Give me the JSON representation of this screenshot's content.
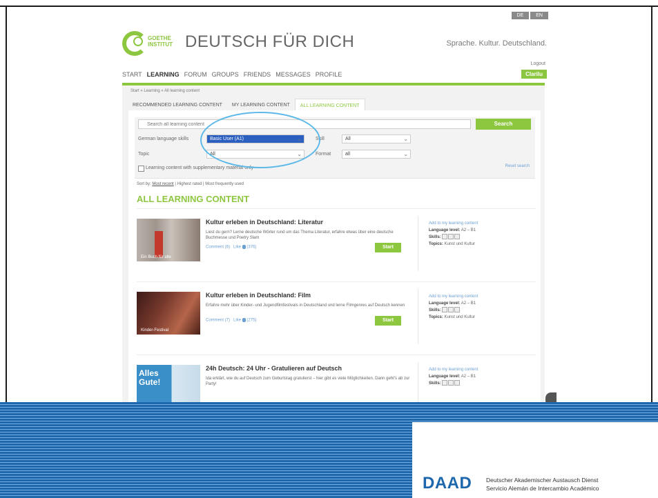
{
  "header": {
    "lang_switch": [
      "DE",
      "EN"
    ],
    "logo_text_1": "GOETHE",
    "logo_text_2": "INSTITUT",
    "site_title": "DEUTSCH FÜR DICH",
    "tagline": "Sprache. Kultur. Deutschland.",
    "logout": "Logout",
    "user": "Clarilu"
  },
  "nav": [
    "START",
    "LEARNING",
    "FORUM",
    "GROUPS",
    "FRIENDS",
    "MESSAGES",
    "PROFILE"
  ],
  "breadcrumb": "Start » Learning » All learning content",
  "tabs": [
    "RECOMMENDED LEARNING CONTENT",
    "MY LEARNING CONTENT",
    "ALL LEARNING CONTENT"
  ],
  "filters": {
    "search_placeholder": "Search all learning content",
    "search_button": "Search",
    "lang_skills_label": "German language skills",
    "lang_skills_value": "Basic User (A1)",
    "skill_label": "Skill",
    "skill_value": "All",
    "topic_label": "Topic",
    "topic_value": "All",
    "format_label": "Format",
    "format_value": "all",
    "checkbox_label": "Learning content with supplementary material only",
    "reset": "Reset search"
  },
  "sort": {
    "label": "Sort by:",
    "most_recent": "Most recent",
    "highest_rated": "Highest rated",
    "most_used": "Most frequently used"
  },
  "section_title": "ALL LEARNING CONTENT",
  "items": [
    {
      "title": "Kultur erleben in Deutschland: Literatur",
      "desc": "Liest du gern? Lerne deutsche Wörter rund um das Thema Literatur, erfahre etwas über eine deutsche Buchmesse und Poetry Slam",
      "comment": "Comment (6)",
      "like": "Like",
      "like_count": "(376)",
      "start": "Start",
      "add": "Add to my learning content",
      "level_label": "Language level:",
      "level": "A2 – B1",
      "skills_label": "Skills:",
      "topics_label": "Topics:",
      "topics": "Kunst und Kultur",
      "thumb_caption": "Ein Buch für alle",
      "thumb_color": "#8a7b72"
    },
    {
      "title": "Kultur erleben in Deutschland: Film",
      "desc": "Erfahre mehr über Kinder- und Jugendfilmfestivals in Deutschland und lerne Filmgenres auf Deutsch kennen",
      "comment": "Comment (7)",
      "like": "Like",
      "like_count": "(275)",
      "start": "Start",
      "add": "Add to my learning content",
      "level_label": "Language level:",
      "level": "A2 – B1",
      "skills_label": "Skills:",
      "topics_label": "Topics:",
      "topics": "Kunst und Kultur",
      "thumb_caption": "Kinder-Festival",
      "thumb_color": "#7a3b2e"
    },
    {
      "title": "24h Deutsch: 24 Uhr - Gratulieren auf Deutsch",
      "desc": "Ida erklärt, wie du auf Deutsch zum Geburtstag gratulierst – hier gibt es viele Möglichkeiten. Dann geht's ab zur Party!",
      "add": "Add to my learning content",
      "level_label": "Language level:",
      "level": "A2 – B1",
      "skills_label": "Skills:",
      "thumb_caption": "Alles Gute!",
      "thumb_color": "#3a8fc8"
    }
  ],
  "footer": {
    "daad": "DAAD",
    "line1": "Deutscher Akademischer Austausch Dienst",
    "line2": "Servicio Alemán de Intercambio Académico"
  }
}
